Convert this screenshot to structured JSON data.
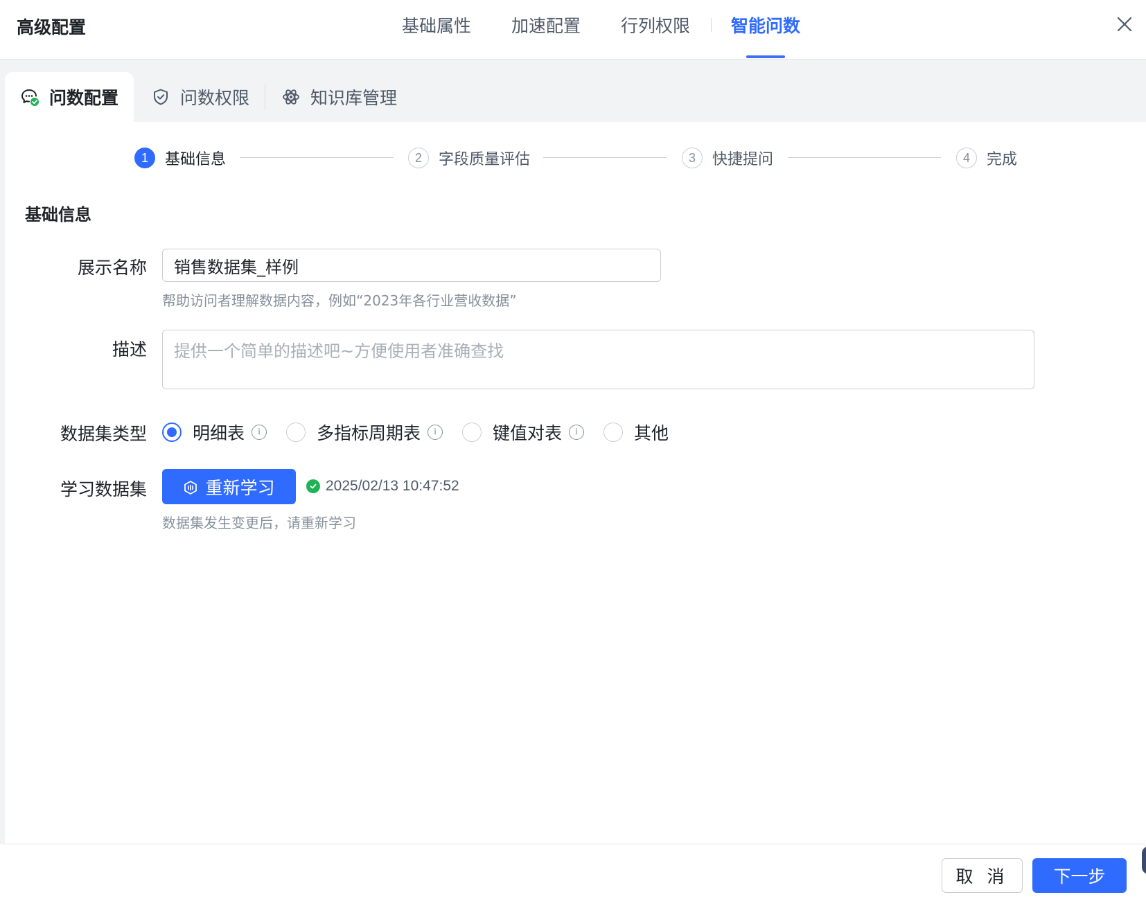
{
  "dialog": {
    "title": "高级配置",
    "close_icon": "close-icon"
  },
  "top_tabs": [
    {
      "label": "基础属性",
      "active": false
    },
    {
      "label": "加速配置",
      "active": false
    },
    {
      "label": "行列权限",
      "active": false
    },
    {
      "label": "智能问数",
      "active": true
    }
  ],
  "sub_tabs": [
    {
      "label": "问数配置",
      "icon": "chat-check-icon",
      "active": true
    },
    {
      "label": "问数权限",
      "icon": "shield-check-icon",
      "active": false
    },
    {
      "label": "知识库管理",
      "icon": "atom-icon",
      "active": false
    }
  ],
  "steps": [
    {
      "num": "1",
      "label": "基础信息",
      "active": true
    },
    {
      "num": "2",
      "label": "字段质量评估",
      "active": false
    },
    {
      "num": "3",
      "label": "快捷提问",
      "active": false
    },
    {
      "num": "4",
      "label": "完成",
      "active": false
    }
  ],
  "section_title": "基础信息",
  "form": {
    "display_name": {
      "label": "展示名称",
      "value": "销售数据集_样例",
      "hint": "帮助访问者理解数据内容，例如“2023年各行业营收数据”"
    },
    "description": {
      "label": "描述",
      "placeholder": "提供一个简单的描述吧~方便使用者准确查找"
    },
    "dataset_type": {
      "label": "数据集类型",
      "options": [
        {
          "label": "明细表",
          "checked": true,
          "info": true
        },
        {
          "label": "多指标周期表",
          "checked": false,
          "info": true
        },
        {
          "label": "键值对表",
          "checked": false,
          "info": true
        },
        {
          "label": "其他",
          "checked": false,
          "info": false
        }
      ]
    },
    "learn": {
      "label": "学习数据集",
      "button": "重新学习",
      "status_time": "2025/02/13 10:47:52",
      "hint": "数据集发生变更后，请重新学习"
    }
  },
  "footer": {
    "cancel": "取 消",
    "next": "下一步"
  },
  "colors": {
    "primary": "#2f6bff",
    "success": "#1fb356"
  }
}
